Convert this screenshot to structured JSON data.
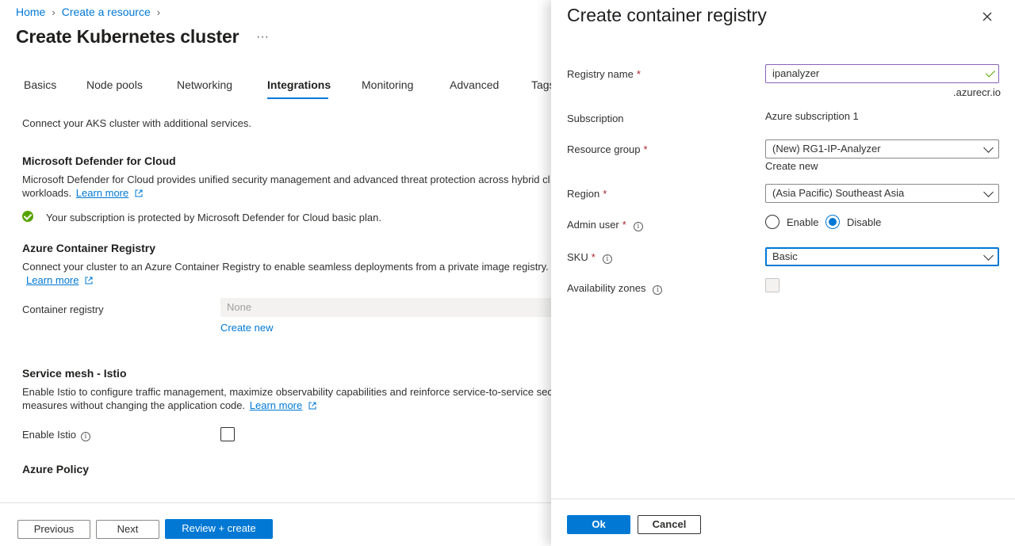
{
  "breadcrumb": {
    "home": "Home",
    "create_resource": "Create a resource"
  },
  "page": {
    "title": "Create Kubernetes cluster",
    "more": "···"
  },
  "tabs": [
    {
      "label": "Basics"
    },
    {
      "label": "Node pools"
    },
    {
      "label": "Networking"
    },
    {
      "label": "Integrations"
    },
    {
      "label": "Monitoring"
    },
    {
      "label": "Advanced"
    },
    {
      "label": "Tags"
    }
  ],
  "intro": "Connect your AKS cluster with additional services.",
  "defender": {
    "heading": "Microsoft Defender for Cloud",
    "desc_line1": "Microsoft Defender for Cloud provides unified security management and advanced threat protection across hybrid cl",
    "desc_line2": "workloads.",
    "learn_more": "Learn more",
    "status": "Your subscription is protected by Microsoft Defender for Cloud basic plan."
  },
  "acr": {
    "heading": "Azure Container Registry",
    "desc": "Connect your cluster to an Azure Container Registry to enable seamless deployments from a private image registry.",
    "learn_more": "Learn more",
    "label": "Container registry",
    "value": "None",
    "create_new": "Create new"
  },
  "istio": {
    "heading": "Service mesh - Istio",
    "desc_line1": "Enable Istio to configure traffic management, maximize observability capabilities and reinforce service-to-service secu",
    "desc_line2": "measures without changing the application code.",
    "learn_more": "Learn more",
    "label": "Enable Istio"
  },
  "policy": {
    "heading": "Azure Policy"
  },
  "footer": {
    "previous": "Previous",
    "next": "Next",
    "review": "Review + create"
  },
  "panel": {
    "title": "Create container registry",
    "registry_name": {
      "label": "Registry name",
      "value": "ipanalyzer",
      "suffix": ".azurecr.io"
    },
    "subscription": {
      "label": "Subscription",
      "value": "Azure subscription 1"
    },
    "resource_group": {
      "label": "Resource group",
      "value": "(New) RG1-IP-Analyzer",
      "create_new": "Create new"
    },
    "region": {
      "label": "Region",
      "value": "(Asia Pacific) Southeast Asia"
    },
    "admin_user": {
      "label": "Admin user",
      "options": [
        "Enable",
        "Disable"
      ],
      "selected": "Disable"
    },
    "sku": {
      "label": "SKU",
      "value": "Basic"
    },
    "availability_zones": {
      "label": "Availability zones",
      "checked": false
    },
    "ok": "Ok",
    "cancel": "Cancel"
  },
  "colors": {
    "accent": "#0078d4",
    "required": "#a4262c",
    "success": "#57a300"
  }
}
